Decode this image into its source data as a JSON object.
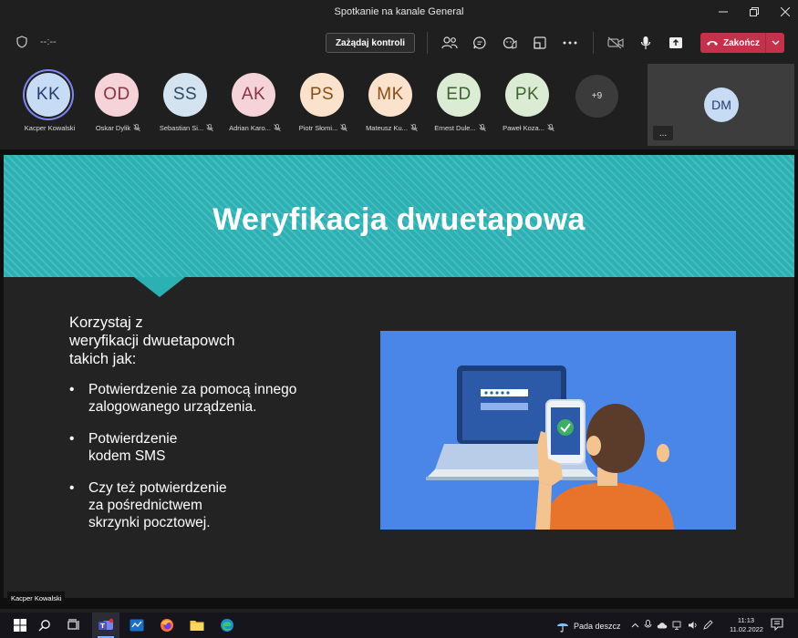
{
  "window": {
    "title": "Spotkanie na kanale General"
  },
  "toolbar": {
    "timer": "--:--",
    "request_control_label": "Zażądaj kontroli",
    "end_label": "Zakończ"
  },
  "participants": [
    {
      "initials": "KK",
      "name": "Kacper Kowalski",
      "muted": false,
      "bg": "#c7dbf5",
      "fg": "#233d69"
    },
    {
      "initials": "OD",
      "name": "Oskar Dylik",
      "muted": true,
      "bg": "#f5d3d9",
      "fg": "#8a3342"
    },
    {
      "initials": "SS",
      "name": "Sebastian Si...",
      "muted": true,
      "bg": "#d4e3f0",
      "fg": "#2f4a63"
    },
    {
      "initials": "AK",
      "name": "Adrian Karo...",
      "muted": true,
      "bg": "#f5d3d9",
      "fg": "#8a3342"
    },
    {
      "initials": "PS",
      "name": "Piotr Słomi...",
      "muted": true,
      "bg": "#fbe2cc",
      "fg": "#8a4d17"
    },
    {
      "initials": "MK",
      "name": "Mateusz Ku...",
      "muted": true,
      "bg": "#fbe2cc",
      "fg": "#8a4d17"
    },
    {
      "initials": "ED",
      "name": "Ernest Dule...",
      "muted": true,
      "bg": "#dcebd3",
      "fg": "#3d6330"
    },
    {
      "initials": "PK",
      "name": "Paweł Koza...",
      "muted": true,
      "bg": "#dcebd3",
      "fg": "#3d6330"
    }
  ],
  "more_participants": "+9",
  "self_tile": {
    "initials": "DM",
    "more_label": "..."
  },
  "slide": {
    "title": "Weryfikacja dwuetapowa",
    "intro_lines": [
      "Korzystaj z",
      "weryfikacji dwuetapowch",
      "takich jak:"
    ],
    "bullets": [
      [
        "Potwierdzenie za pomocą innego",
        "zalogowanego urządzenia."
      ],
      [
        "Potwierdzenie",
        "kodem SMS"
      ],
      [
        "Czy też potwierdzenie",
        "za pośrednictwem",
        "skrzynki pocztowej."
      ]
    ]
  },
  "presenter_tag": "Kacper Kowalski",
  "taskbar": {
    "weather": "Pada deszcz",
    "time": "11:13",
    "date": "11.02.2022"
  },
  "colors": {
    "accent_teal": "#2bb0b3",
    "end_red": "#c4314b",
    "illustration_blue": "#4a86e8"
  }
}
